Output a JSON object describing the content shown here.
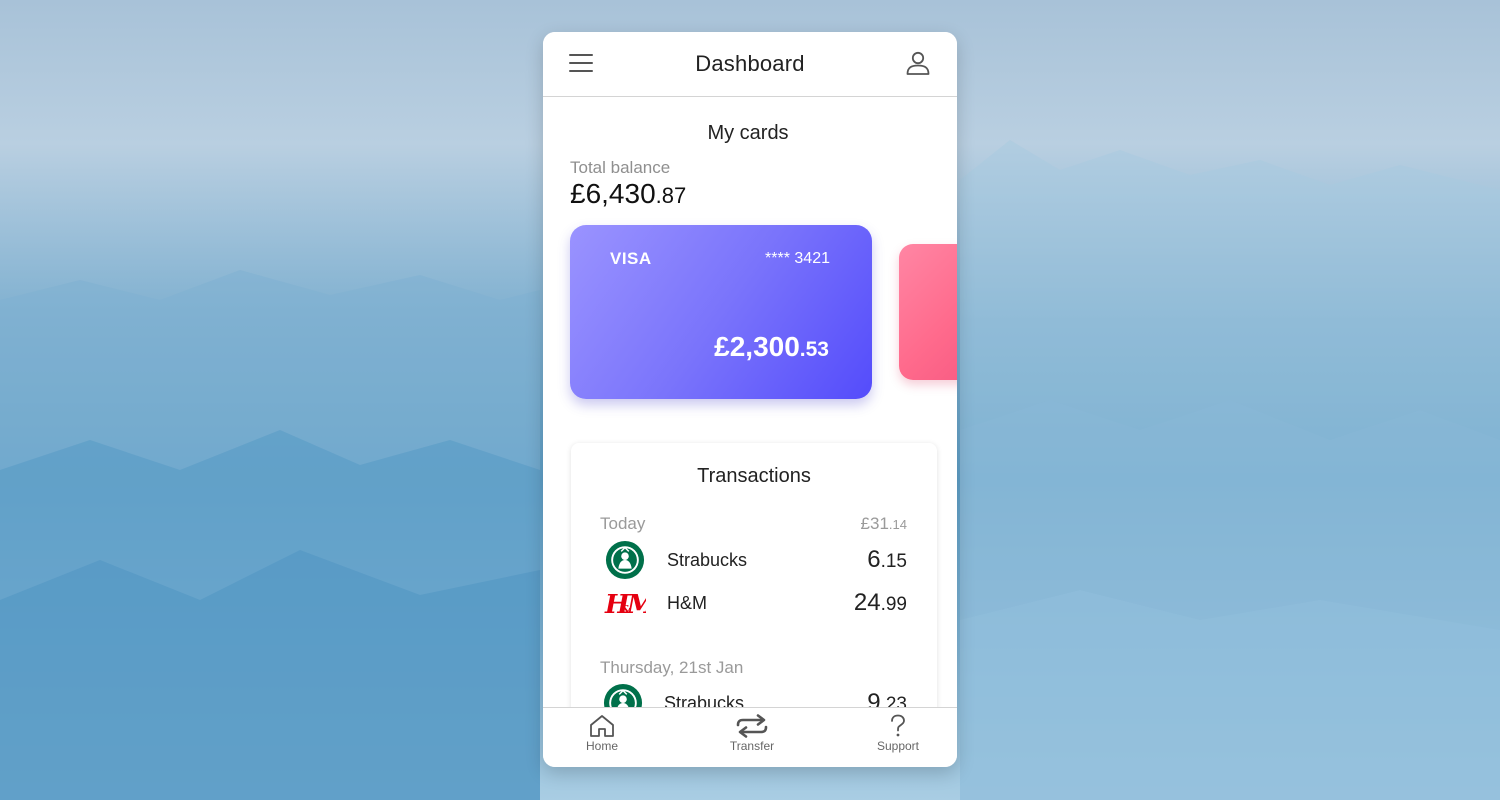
{
  "header": {
    "title": "Dashboard",
    "menu_icon": "hamburger-menu-icon",
    "profile_icon": "user-profile-icon"
  },
  "cards_section": {
    "title": "My cards",
    "total_balance_label": "Total balance",
    "total_balance_main": "£6,430",
    "total_balance_frac": ".87"
  },
  "cards": [
    {
      "brand": "VISA",
      "number": "**** 3421",
      "balance_main": "£2,300",
      "balance_frac": ".53",
      "gradient": [
        "#9a93ff",
        "#544cfb"
      ]
    },
    {
      "gradient": [
        "#ff86a4",
        "#f75a82"
      ]
    }
  ],
  "transactions": {
    "title": "Transactions",
    "groups": [
      {
        "date": "Today",
        "total_main": "£31",
        "total_frac": ".14",
        "items": [
          {
            "name": "Strabucks",
            "logo": "starbucks-logo",
            "amount_main": "6",
            "amount_frac": ".15"
          },
          {
            "name": "H&M",
            "logo": "hm-logo",
            "amount_main": "24",
            "amount_frac": ".99"
          }
        ]
      },
      {
        "date": "Thursday, 21st Jan",
        "items": [
          {
            "name": "Strabucks",
            "logo": "starbucks-logo",
            "amount_main": "9",
            "amount_frac": ".23"
          }
        ]
      }
    ]
  },
  "nav": {
    "items": [
      {
        "label": "Home",
        "icon": "home-icon"
      },
      {
        "label": "Transfer",
        "icon": "transfer-icon"
      },
      {
        "label": "Support",
        "icon": "question-mark-icon"
      }
    ]
  },
  "colors": {
    "accent": "#544cfb",
    "secondary_card": "#ff6a8c",
    "starbucks_green": "#00704a",
    "hm_red": "#e50010"
  }
}
